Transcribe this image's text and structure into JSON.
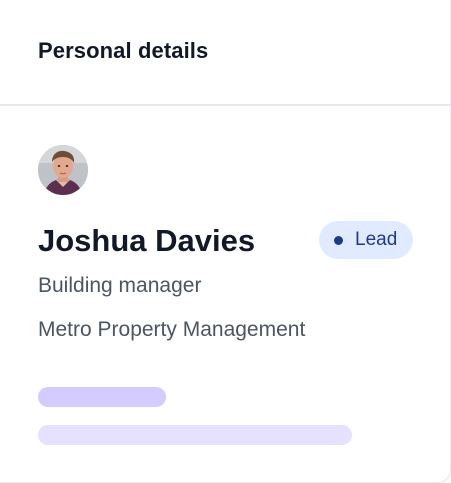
{
  "card": {
    "title": "Personal details"
  },
  "person": {
    "avatar_icon": "person-avatar-photo",
    "name": "Joshua Davies",
    "role": "Building manager",
    "company": "Metro Property Management"
  },
  "badge": {
    "label": "Lead",
    "background": "#e1ebff",
    "dot_color": "#1e3a8a",
    "text_color": "#1e3a8a"
  },
  "skeleton": {
    "bar_primary_color": "#d4ccff",
    "bar_secondary_color": "#e5e1ff"
  }
}
